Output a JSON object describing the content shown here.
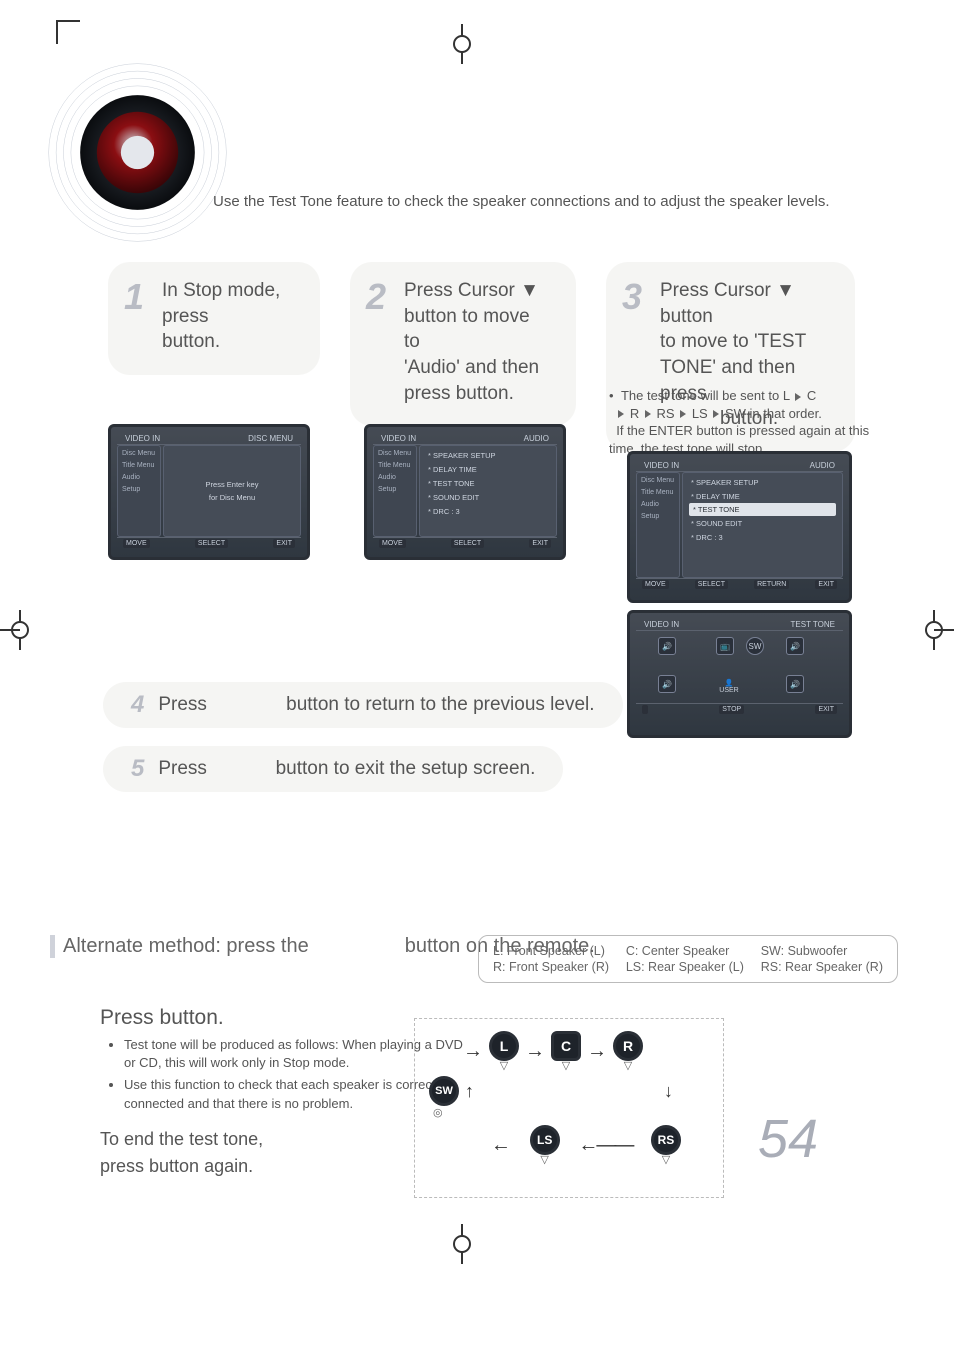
{
  "intro": "Use the Test Tone feature to check the speaker connections and to adjust the speaker levels.",
  "steps": {
    "s1": {
      "num": "1",
      "l1": "In Stop mode,",
      "l2": "press",
      "l3": "button."
    },
    "s2": {
      "num": "2",
      "l1": "Press Cursor  ▼",
      "l2": "button to move to",
      "l3": "'Audio' and then",
      "l4": "press            button."
    },
    "s3": {
      "num": "3",
      "l1": "Press Cursor ▼ button",
      "l2": "to move to 'TEST",
      "l3": "TONE' and then press",
      "l4": "button."
    }
  },
  "note": {
    "bullet": "•",
    "l1": "The test tone will be sent to L",
    "seq_c": "C",
    "seq_r": "R",
    "seq_rs": "RS",
    "seq_ls": "LS",
    "seq_sw": "SW",
    "l2": "in that order.",
    "l3": "If the ENTER button is pressed again at this time, the test tone will stop."
  },
  "osd": {
    "title": "VIDEO IN",
    "menu_hdr1": "DISC MENU",
    "menu_hdr2": "AUDIO",
    "side": [
      "Disc Menu",
      "Title Menu",
      "Audio",
      "Setup"
    ],
    "center": {
      "l1": "Press Enter key",
      "l2": "for Disc Menu"
    },
    "audio_items": [
      "* SPEAKER SETUP",
      "* DELAY TIME",
      "* TEST TONE",
      "* SOUND EDIT",
      "* DRC                : 3"
    ],
    "ftr_move": "MOVE",
    "ftr_select": "SELECT",
    "ftr_return": "RETURN",
    "ftr_exit": "EXIT",
    "tt_hdr": "TEST TONE",
    "tt_stop": "STOP",
    "tt_user": "USER"
  },
  "instr": {
    "i4": {
      "num": "4",
      "pre": "Press",
      "post": "button to return to the previous level."
    },
    "i5": {
      "num": "5",
      "pre": "Press",
      "post": "button to exit the setup screen."
    }
  },
  "footer": {
    "alt_pre": "Alternate method: press the",
    "alt_post": "button on the remote.",
    "legend": {
      "L": "L: Front Speaker (L)",
      "R": "R: Front Speaker (R)",
      "C": "C: Center Speaker",
      "LS": "LS: Rear Speaker (L)",
      "SW": "SW: Subwoofer",
      "RS": "RS: Rear Speaker (R)"
    },
    "press": "Press               button.",
    "b1": "Test tone will be produced as follows: When playing a DVD or CD, this will work only in Stop mode.",
    "b2": "Use this function to check that each speaker is correctly connected and that there is no problem.",
    "end1": "To end the test tone,",
    "end2": "press                  button again.",
    "spk": {
      "L": "L",
      "C": "C",
      "R": "R",
      "SW": "SW",
      "LS": "LS",
      "RS": "RS"
    }
  },
  "page": "54"
}
